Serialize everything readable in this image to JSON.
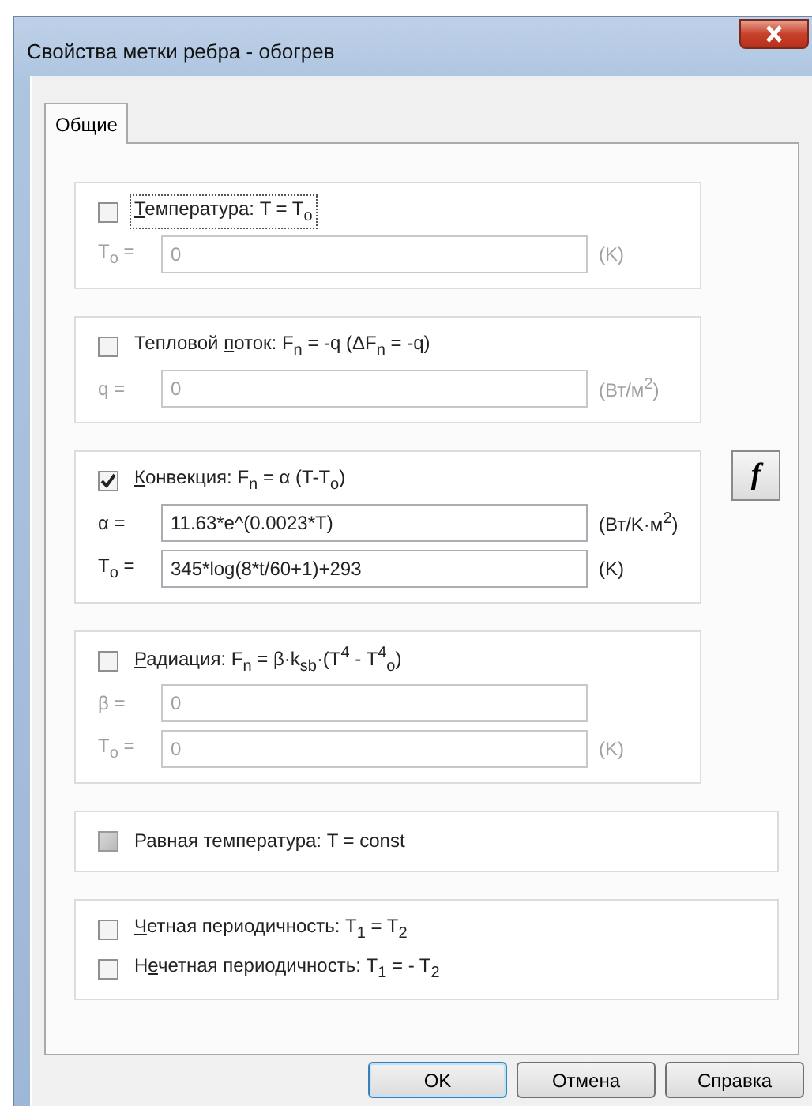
{
  "window": {
    "title": "Свойства метки ребра - обогрев"
  },
  "tabs": [
    {
      "label": "Общие",
      "selected": true
    }
  ],
  "groups": [
    {
      "kind": "formula",
      "checkboxes": [
        {
          "key": "Т",
          "after": "емпература: T = T$_{o}$",
          "checked": false,
          "focused": true,
          "disabled": false
        }
      ],
      "fields": [
        {
          "label": "T$_{o}$ =",
          "value": "0",
          "unit": "(K)"
        }
      ]
    },
    {
      "kind": "formula",
      "checkboxes": [
        {
          "before": "Тепловой ",
          "key": "п",
          "after": "оток: F$_{n}$ = -q (ΔF$_{n}$ = -q)",
          "checked": false,
          "focused": false,
          "disabled": false
        }
      ],
      "fields": [
        {
          "label": "q =",
          "value": "0",
          "unit": "(Вт/м$^{2}$)"
        }
      ]
    },
    {
      "kind": "formula",
      "formula_button": "f",
      "checkboxes": [
        {
          "key": "К",
          "after": "онвекция: F$_{n}$ = α (T-T$_{o}$)",
          "checked": true,
          "focused": false,
          "disabled": false
        }
      ],
      "fields": [
        {
          "label": "α =",
          "value": "11.63*e^(0.0023*T)",
          "unit": "(Вт/K·м$^{2}$)"
        },
        {
          "label": "T$_{o}$ =",
          "value": "345*log(8*t/60+1)+293",
          "unit": "(K)"
        }
      ]
    },
    {
      "kind": "formula",
      "checkboxes": [
        {
          "key": "Р",
          "after": "адиация: F$_{n}$ = β·k$_{sb}$·(T$^{4}$ - T$^{4}$$_{o}$)",
          "checked": false,
          "focused": false,
          "disabled": false
        }
      ],
      "fields": [
        {
          "label": "β =",
          "value": "0"
        },
        {
          "label": "T$_{o}$ =",
          "value": "0",
          "unit": "(K)"
        }
      ]
    },
    {
      "kind": "option",
      "checkboxes": [
        {
          "before": "Равная температура: T = const",
          "checked": false,
          "focused": false,
          "disabled": true
        }
      ]
    },
    {
      "kind": "option",
      "checkboxes": [
        {
          "key": "Ч",
          "after": "етная периодичность: T$_{1}$ = T$_{2}$",
          "checked": false,
          "focused": false,
          "disabled": false
        },
        {
          "before": "Н",
          "key": "е",
          "after": "четная периодичность: T$_{1}$ = - T$_{2}$",
          "checked": false,
          "focused": false,
          "disabled": false
        }
      ]
    }
  ],
  "buttons": [
    {
      "label": "OK",
      "default": true
    },
    {
      "label": "Отмена",
      "default": false
    },
    {
      "label": "Справка",
      "default": false
    }
  ]
}
